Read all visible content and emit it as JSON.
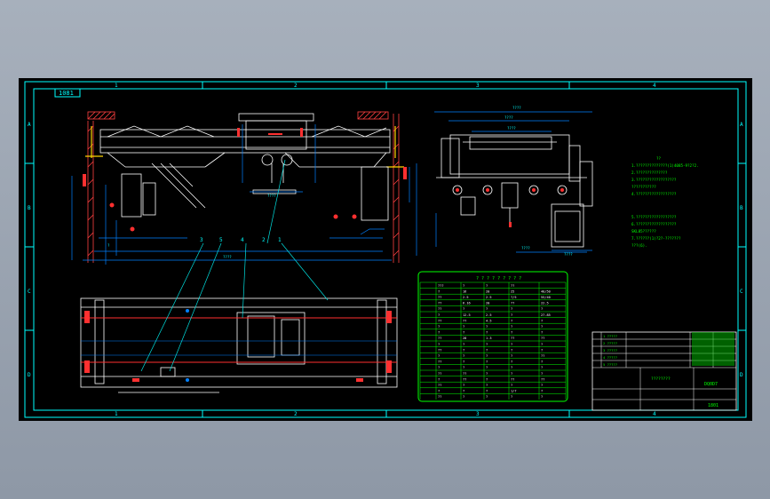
{
  "title_tag": "1081",
  "zones": {
    "top": [
      "1",
      "2",
      "3",
      "4"
    ],
    "side": [
      "A",
      "B",
      "C",
      "D"
    ]
  },
  "balloons": [
    "3",
    "5",
    "4",
    "2",
    "1"
  ],
  "tech_notes": {
    "lines": [
      "??",
      "1.??????????????(1)4085-9?2?2.",
      "2.??????????????",
      "3.??????????????????",
      "  ???????????",
      "4.??????????????????",
      "5.??????????????????",
      "6.??????????????????",
      "   SKL85??????",
      "7.??????(1)?2?-???????",
      "   ???(6)."
    ]
  },
  "param_table": {
    "title": "? ? ? ? ? ? ? ? ?",
    "rows": [
      [
        "???",
        "?",
        "?",
        "??"
      ],
      [
        "?",
        "16",
        "20",
        "25",
        "40/50"
      ],
      [
        "??",
        "2.5",
        "2.5",
        "?/5",
        "55/40"
      ],
      [
        "??",
        "6.16",
        "20",
        "??",
        "22.5"
      ],
      [
        "??",
        "?",
        "?",
        "?",
        "?"
      ],
      [
        "?",
        "12.5",
        "2.5",
        "?",
        "27.85"
      ],
      [
        "??",
        "??",
        "4.5",
        "?",
        "?"
      ],
      [
        "?",
        "?",
        "?",
        "?",
        "?"
      ],
      [
        "?",
        "?",
        "?",
        "?",
        "?"
      ],
      [
        "??",
        "28",
        "1.3",
        "??",
        "??"
      ],
      [
        "?",
        "?",
        "?",
        "?",
        "?"
      ],
      [
        "??",
        "?",
        "?",
        "?",
        "?"
      ],
      [
        "?",
        "?",
        "?",
        "?",
        "??"
      ],
      [
        "??",
        "?",
        "?",
        "?",
        "?"
      ],
      [
        "?",
        "?",
        "?",
        "?",
        "?"
      ],
      [
        "??",
        "??",
        "?",
        "?",
        "?"
      ],
      [
        "?",
        "??",
        "?",
        "??",
        "??"
      ],
      [
        "??",
        "?",
        "?",
        "?",
        "?"
      ],
      [
        "?",
        "?",
        "?",
        "1/?",
        "?"
      ],
      [
        "??",
        "?",
        "?",
        "?",
        "?"
      ]
    ]
  },
  "title_block": {
    "parts": [
      "1 ?????",
      "2 ?????",
      "3 ?????",
      "4 ?????",
      "5 ?????"
    ],
    "drawing_title": "????????",
    "drawing_no": "DQ0D7",
    "code": "1801"
  },
  "colors": {
    "background": "#000000",
    "frame": "#00ffff",
    "structure": "#ffffff",
    "dimension": "#0080ff",
    "leader": "#00e0e0",
    "table": "#00ff00",
    "accent": "#ff3030",
    "hatch": "#ff4040"
  }
}
